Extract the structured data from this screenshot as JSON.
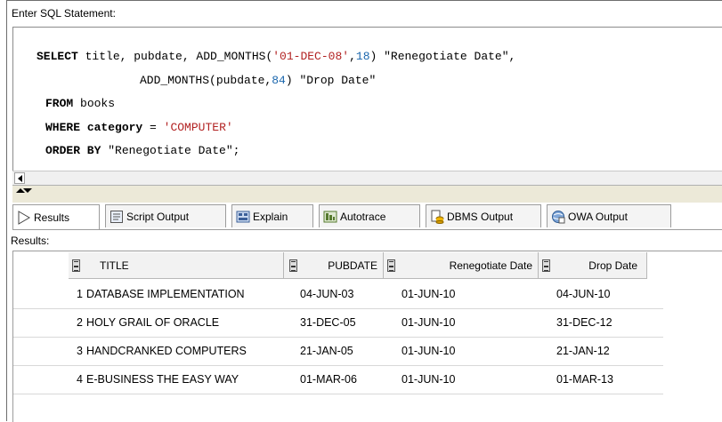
{
  "editor": {
    "label": "Enter SQL Statement:",
    "sql": {
      "line1": {
        "kw": "SELECT",
        "a": " title, pubdate, ADD_MONTHS(",
        "s1": "'01-DEC-08'",
        "b": ",",
        "n1": "18",
        "c": ") \"Renegotiate Date\","
      },
      "line2": {
        "a": "ADD_MONTHS(pubdate,",
        "n1": "84",
        "b": ") \"Drop Date\""
      },
      "line3": {
        "kw": "FROM",
        "a": " books"
      },
      "line4": {
        "kw": "WHERE",
        "kw2": "category",
        "a": " = ",
        "s1": "'COMPUTER'"
      },
      "line5": {
        "kw": "ORDER BY",
        "a": " \"Renegotiate Date\";"
      }
    }
  },
  "tabs": [
    {
      "label": "Results",
      "icon": "play-arrow-icon",
      "active": true
    },
    {
      "label": "Script Output",
      "icon": "script-output-icon",
      "active": false
    },
    {
      "label": "Explain",
      "icon": "explain-plan-icon",
      "active": false
    },
    {
      "label": "Autotrace",
      "icon": "autotrace-icon",
      "active": false
    },
    {
      "label": "DBMS Output",
      "icon": "dbms-output-icon",
      "active": false
    },
    {
      "label": "OWA Output",
      "icon": "owa-output-icon",
      "active": false
    }
  ],
  "results": {
    "label": "Results:",
    "columns": [
      "TITLE",
      "PUBDATE",
      "Renegotiate Date",
      "Drop Date"
    ],
    "rows": [
      [
        "1",
        "DATABASE IMPLEMENTATION",
        "04-JUN-03",
        "01-JUN-10",
        "04-JUN-10"
      ],
      [
        "2",
        "HOLY GRAIL OF ORACLE",
        "31-DEC-05",
        "01-JUN-10",
        "31-DEC-12"
      ],
      [
        "3",
        "HANDCRANKED COMPUTERS",
        "21-JAN-05",
        "01-JUN-10",
        "21-JAN-12"
      ],
      [
        "4",
        "E-BUSINESS THE EASY WAY",
        "01-MAR-06",
        "01-JUN-10",
        "01-MAR-13"
      ]
    ]
  },
  "colors": {
    "string_literal": "#b22222",
    "number_literal": "#1a66ad",
    "chrome": "#ece9d8"
  }
}
